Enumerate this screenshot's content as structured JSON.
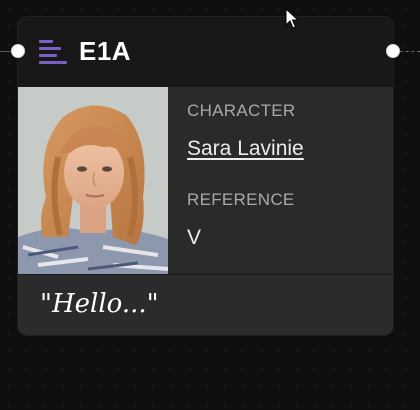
{
  "node": {
    "title": "E1A",
    "character_label": "CHARACTER",
    "character_name": "Sara Lavinie",
    "reference_label": "REFERENCE",
    "reference_value": "V",
    "dialogue": "\"Hello...\""
  },
  "icons": {
    "menu": "menu-lines-icon",
    "cursor": "arrow-cursor-icon",
    "portrait": "character-portrait"
  },
  "colors": {
    "canvas_background": "#0f0f10",
    "node_background": "#181819",
    "panel_background": "#2a2a2b",
    "accent": "#7b5fc2",
    "port": "#ffffff"
  }
}
